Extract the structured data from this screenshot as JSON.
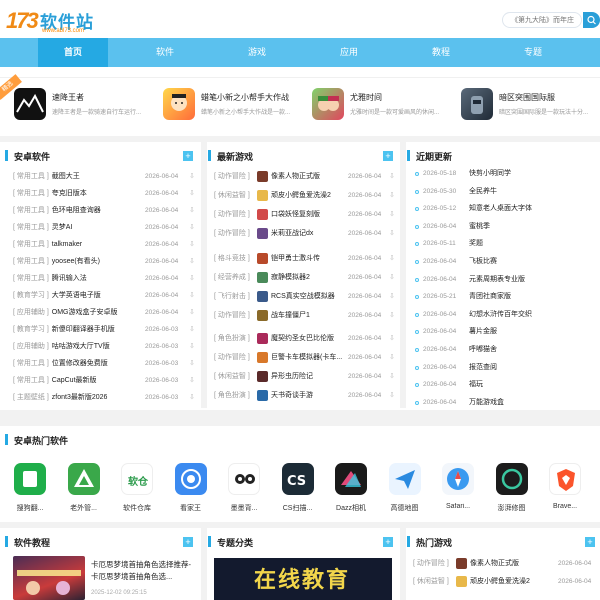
{
  "header": {
    "logo_number": "173",
    "logo_name": "软件站",
    "logo_url": "www.abl73.com",
    "search_placeholder": "《第九大陆》而年庄"
  },
  "nav": [
    "首页",
    "软件",
    "游戏",
    "应用",
    "教程",
    "专题"
  ],
  "featured_badge": "精选",
  "featured": [
    {
      "title": "速降王者",
      "desc": "速降王者是一款骑速自行车运行..."
    },
    {
      "title": "蜡笔小新之小帮手大作战",
      "desc": "蜡笔小新之小帮手大作战是一款..."
    },
    {
      "title": "尤雅时间",
      "desc": "尤雅时间是一款可爱画风的休闲..."
    },
    {
      "title": "暗区突围国际服",
      "desc": "暗区突围国际服是一款玩法十分..."
    }
  ],
  "panels": {
    "software": {
      "title": "安卓软件",
      "rows": [
        {
          "cat": "[ 常用工具 ]",
          "title": "截图大王",
          "date": "2026-06-04"
        },
        {
          "cat": "[ 常用工具 ]",
          "title": "夸克旧版本",
          "date": "2026-06-04"
        },
        {
          "cat": "[ 常用工具 ]",
          "title": "色环电阻查询器",
          "date": "2026-06-04"
        },
        {
          "cat": "[ 常用工具 ]",
          "title": "灵梦AI",
          "date": "2026-06-04"
        },
        {
          "cat": "[ 常用工具 ]",
          "title": "talkmaker",
          "date": "2026-06-04"
        },
        {
          "cat": "[ 常用工具 ]",
          "title": "yoosee(有看头)",
          "date": "2026-06-04"
        },
        {
          "cat": "[ 常用工具 ]",
          "title": "腾讯输入法",
          "date": "2026-06-04"
        },
        {
          "cat": "[ 教育学习 ]",
          "title": "大学英语电子版",
          "date": "2026-06-04"
        },
        {
          "cat": "[ 应用辅助 ]",
          "title": "OMG游戏盒子安卓版",
          "date": "2026-06-04"
        },
        {
          "cat": "[ 教育学习 ]",
          "title": "新傻印翻译器手机版",
          "date": "2026-06-03"
        },
        {
          "cat": "[ 应用辅助 ]",
          "title": "咕咕游戏大厅TV版",
          "date": "2026-06-03"
        },
        {
          "cat": "[ 常用工具 ]",
          "title": "位置修改器免费版",
          "date": "2026-06-03"
        },
        {
          "cat": "[ 常用工具 ]",
          "title": "CapCut最新版",
          "date": "2026-06-03"
        },
        {
          "cat": "[ 主题壁纸 ]",
          "title": "zfont3最新版2026",
          "date": "2026-06-03"
        }
      ]
    },
    "games": {
      "title": "最新游戏",
      "rows": [
        {
          "cat": "[ 动作冒险 ]",
          "title": "像素人物正式版",
          "date": "2026-06-04"
        },
        {
          "cat": "[ 休闲益智 ]",
          "title": "顽皮小鳄鱼爱洗澡2",
          "date": "2026-06-04"
        },
        {
          "cat": "[ 动作冒险 ]",
          "title": "口袋妖怪复刻版",
          "date": "2026-06-04"
        },
        {
          "cat": "[ 动作冒险 ]",
          "title": "米莉亚战记dx",
          "date": "2026-06-04"
        },
        {
          "cat": "[ 格斗竞技 ]",
          "title": "铠甲勇士激斗传",
          "date": "2026-06-04"
        },
        {
          "cat": "[ 经营养成 ]",
          "title": "寂静模拟器2",
          "date": "2026-06-04"
        },
        {
          "cat": "[ 飞行射击 ]",
          "title": "RCS真实空战模拟器",
          "date": "2026-06-04"
        },
        {
          "cat": "[ 动作冒险 ]",
          "title": "战车撞僵尸1",
          "date": "2026-06-04"
        },
        {
          "cat": "[ 角色扮演 ]",
          "title": "魔契约圣女巴比伦版",
          "date": "2026-06-04"
        },
        {
          "cat": "[ 动作冒险 ]",
          "title": "巨警卡车模拟器(卡车...",
          "date": "2026-06-04"
        },
        {
          "cat": "[ 休闲益智 ]",
          "title": "异形虫历险记",
          "date": "2026-06-04"
        },
        {
          "cat": "[ 角色扮演 ]",
          "title": "天书奇谈手游",
          "date": "2026-06-04"
        }
      ]
    },
    "updates": {
      "title": "近期更新",
      "rows": [
        {
          "date": "2026-05-18",
          "title": "快剪小明同学"
        },
        {
          "date": "2026-05-30",
          "title": "全民养牛"
        },
        {
          "date": "2026-05-12",
          "title": "知意老人桌面大字体"
        },
        {
          "date": "2026-06-04",
          "title": "蜜桃季"
        },
        {
          "date": "2026-05-11",
          "title": "奖题"
        },
        {
          "date": "2026-06-04",
          "title": "飞板比赛"
        },
        {
          "date": "2026-06-04",
          "title": "元素周期表专业版"
        },
        {
          "date": "2026-05-21",
          "title": "青团社商家版"
        },
        {
          "date": "2026-06-04",
          "title": "幻想水浒传百年交织"
        },
        {
          "date": "2026-06-04",
          "title": "薯片金服"
        },
        {
          "date": "2026-06-04",
          "title": "呼嘟猫舍"
        },
        {
          "date": "2026-06-04",
          "title": "报范查阅"
        },
        {
          "date": "2026-06-04",
          "title": "福玩"
        },
        {
          "date": "2026-06-04",
          "title": "万能游戏盒"
        }
      ]
    }
  },
  "hot": {
    "title": "安卓热门软件",
    "items": [
      "搜狗翻...",
      "老外管...",
      "软件仓库",
      "看家王",
      "墨墨背...",
      "CS扫描...",
      "Dazz相机",
      "高德地图",
      "Safari...",
      "澎湃修图",
      "Brave..."
    ]
  },
  "bottom": {
    "tutorial_title": "软件教程",
    "tutorial_headline": "卡厄思梦境首抽角色选择推荐-卡厄思梦境首抽角色选...",
    "tutorial_date": "2025-12-02 09:25:15",
    "topic_title": "专题分类",
    "topic_banner": "在线教育",
    "hotgame_title": "热门游戏",
    "hotgame_rows": [
      {
        "cat": "[ 动作冒险 ]",
        "title": "像素人物正式版",
        "date": "2026-06-04"
      },
      {
        "cat": "[ 休闲益智 ]",
        "title": "顽皮小鳄鱼爱洗澡2",
        "date": "2026-06-04"
      }
    ]
  },
  "colors": {
    "accent": "#25a9e3",
    "nav_bg": "#5bc1ee",
    "orange": "#f08a16"
  }
}
